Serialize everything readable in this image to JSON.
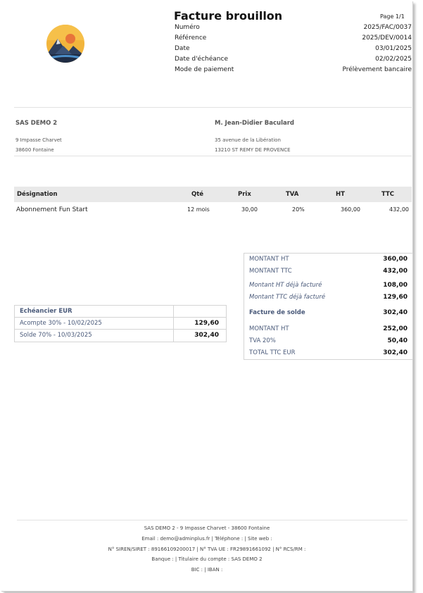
{
  "header": {
    "title": "Facture brouillon",
    "page": "Page 1/1",
    "meta": [
      {
        "label": "Numéro",
        "value": "2025/FAC/0037"
      },
      {
        "label": "Référence",
        "value": "2025/DEV/0014"
      },
      {
        "label": "Date",
        "value": "03/01/2025"
      },
      {
        "label": "Date d'échéance",
        "value": "02/02/2025"
      },
      {
        "label": "Mode de paiement",
        "value": "Prélèvement bancaire"
      }
    ]
  },
  "seller": {
    "name": "SAS DEMO 2",
    "address1": "9 Impasse Charvet",
    "address2": "38600 Fontaine"
  },
  "buyer": {
    "name": "M. Jean-Didier Baculard",
    "address1": "35 avenue de la Libération",
    "address2": "13210 ST REMY DE PROVENCE"
  },
  "lines": {
    "headers": {
      "designation": "Désignation",
      "qty": "Qté",
      "price": "Prix",
      "vat": "TVA",
      "ht": "HT",
      "ttc": "TTC"
    },
    "rows": [
      {
        "designation": "Abonnement Fun Start",
        "qty": "12 mois",
        "price": "30,00",
        "vat": "20%",
        "ht": "360,00",
        "ttc": "432,00"
      }
    ]
  },
  "schedule": {
    "title": "Echéancier EUR",
    "rows": [
      {
        "label": "Acompte 30% - 10/02/2025",
        "amount": "129,60"
      },
      {
        "label": "Solde 70% - 10/03/2025",
        "amount": "302,40"
      }
    ]
  },
  "totals": {
    "montant_ht": {
      "label": "MONTANT HT",
      "value": "360,00"
    },
    "montant_ttc": {
      "label": "MONTANT TTC",
      "value": "432,00"
    },
    "ht_deja": {
      "label": "Montant HT déjà facturé",
      "value": "108,00"
    },
    "ttc_deja": {
      "label": "Montant TTC déjà facturé",
      "value": "129,60"
    },
    "solde": {
      "label": "Facture de solde",
      "value": "302,40"
    },
    "montant_ht2": {
      "label": "MONTANT HT",
      "value": "252,00"
    },
    "tva": {
      "label": "TVA 20%",
      "value": "50,40"
    },
    "total_ttc": {
      "label": "TOTAL TTC EUR",
      "value": "302,40"
    }
  },
  "footer": {
    "line1": "SAS DEMO 2 - 9 Impasse Charvet - 38600 Fontaine",
    "line2": "Email : demo@adminplus.fr | Téléphone : | Site web :",
    "line3": "N° SIREN/SIRET : 89166109200017 | N° TVA UE : FR29891661092 | N° RCS/RM :",
    "line4": "Banque : | Titulaire du compte : SAS DEMO 2",
    "line5": "BIC : | IBAN :"
  },
  "colors": {
    "accent_text": "#4a5a7a",
    "table_header_bg": "#e9e9e9",
    "border": "#d4d4d4"
  },
  "icons": {
    "logo": "mountain-sunset-logo"
  }
}
